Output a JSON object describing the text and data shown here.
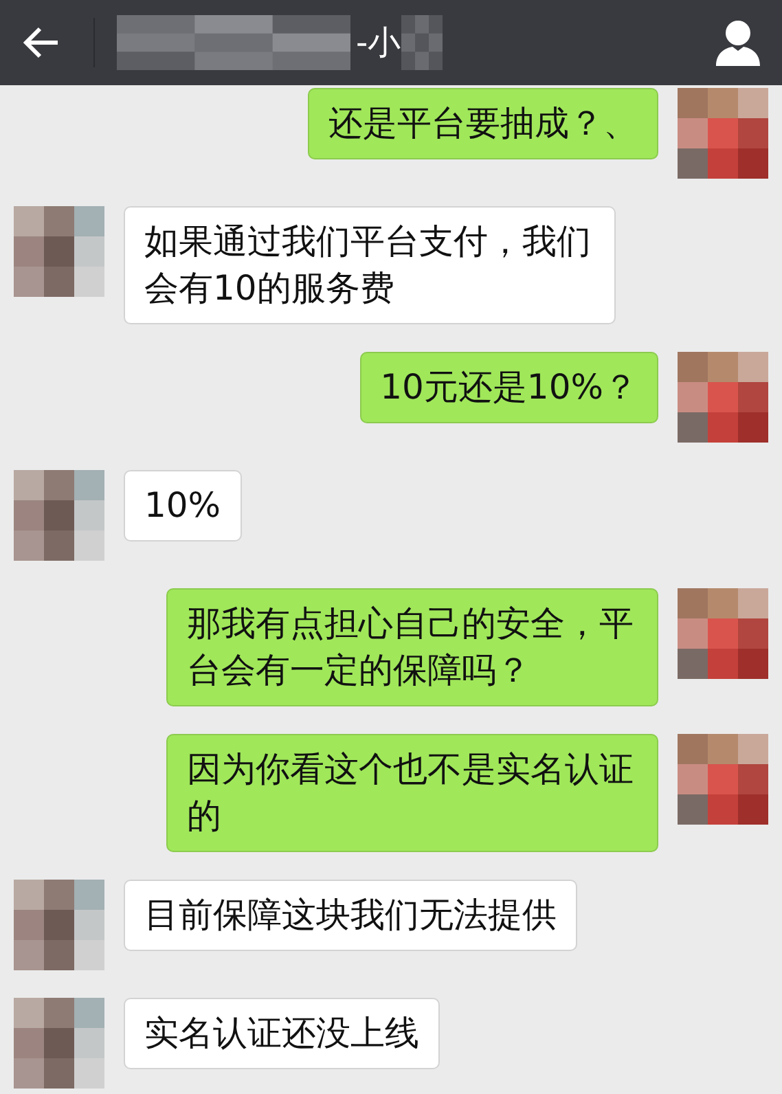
{
  "header": {
    "title": "-小"
  },
  "messages": [
    {
      "kind": "outgoing",
      "text": "还是平台要抽成？、"
    },
    {
      "kind": "incoming",
      "text": "如果通过我们平台支付，我们会有10的服务费"
    },
    {
      "kind": "outgoing",
      "text": "10元还是10%？"
    },
    {
      "kind": "incoming",
      "text": "10%"
    },
    {
      "kind": "outgoing",
      "text": "那我有点担心自己的安全，平台会有一定的保障吗？"
    },
    {
      "kind": "outgoing",
      "text": "因为你看这个也不是实名认证的"
    },
    {
      "kind": "incoming",
      "text": "目前保障这块我们无法提供"
    },
    {
      "kind": "incoming",
      "text": "实名认证还没上线"
    }
  ]
}
